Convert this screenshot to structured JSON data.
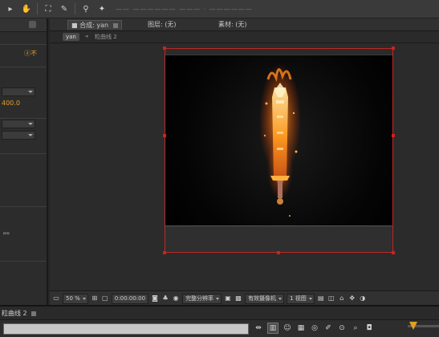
{
  "toolbar": {
    "faded_text": "—— ——————  ———  · ——————"
  },
  "left_panel": {
    "orange_text_1": "ⓐ不",
    "orange_text_2": "400.0"
  },
  "comp_panel": {
    "tabs": [
      {
        "label": "■ 合成: yan"
      },
      {
        "label": "图层: (无)"
      },
      {
        "label": "素材: (无)"
      }
    ],
    "breadcrumbs": {
      "current": "yan",
      "separator": "◂",
      "other": "粒曲线 2"
    }
  },
  "viewer_controls": {
    "zoom": "50 %",
    "timecode": "0:00:00:00",
    "resolution": "完整分辨率",
    "camera": "有效摄像机",
    "views": "1 视图"
  },
  "timeline": {
    "tab_label": "粒曲线 2"
  },
  "colors": {
    "layer_bounds": "#c02828",
    "playhead": "#e0a020"
  },
  "icons": {
    "toolbar": [
      "hand-icon",
      "magnify-icon",
      "rotate-icon",
      "pen-icon",
      "pin-icon"
    ]
  }
}
